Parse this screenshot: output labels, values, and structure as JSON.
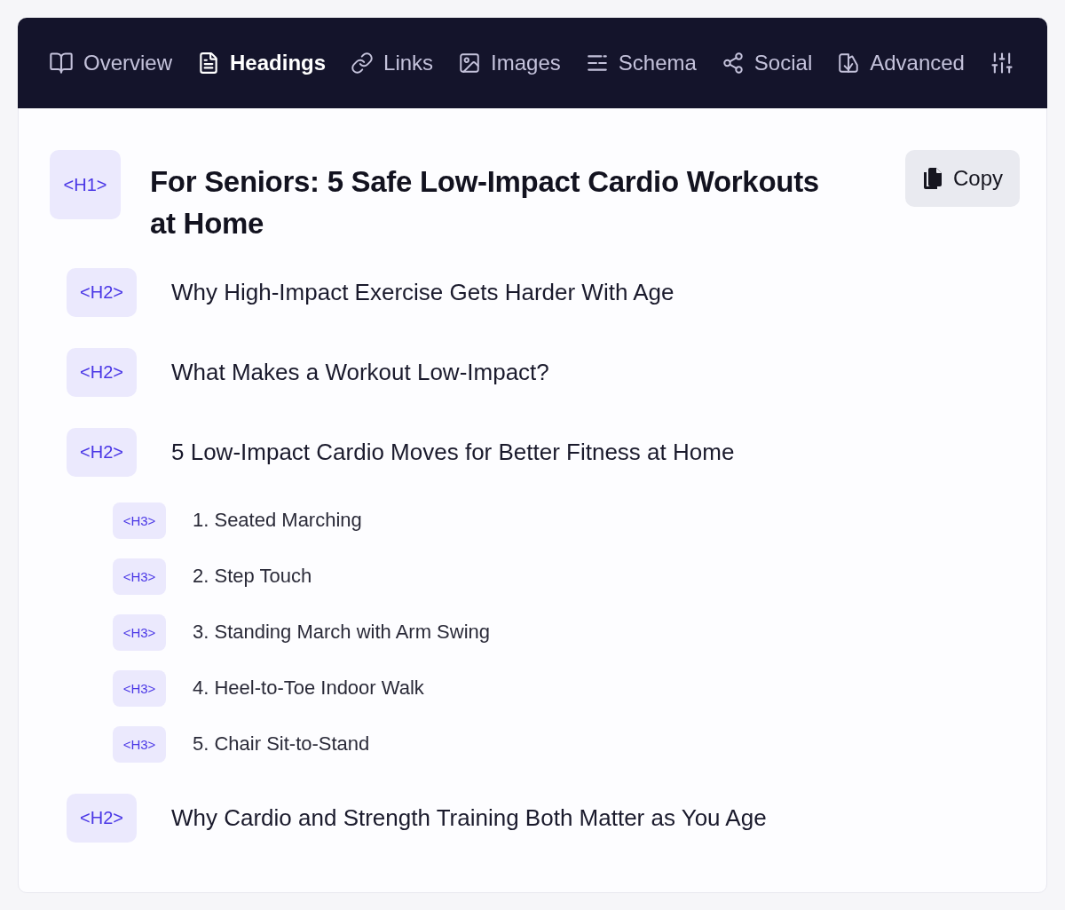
{
  "tabs": [
    {
      "label": "Overview",
      "selected": false
    },
    {
      "label": "Headings",
      "selected": true
    },
    {
      "label": "Links",
      "selected": false
    },
    {
      "label": "Images",
      "selected": false
    },
    {
      "label": "Schema",
      "selected": false
    },
    {
      "label": "Social",
      "selected": false
    },
    {
      "label": "Advanced",
      "selected": false
    }
  ],
  "copy_button": {
    "label": "Copy"
  },
  "headings": [
    {
      "tag": "<H1>",
      "text": "For Seniors: 5 Safe Low-Impact Cardio Workouts at Home",
      "children": [
        {
          "tag": "<H2>",
          "text": "Why High-Impact Exercise Gets Harder With Age"
        },
        {
          "tag": "<H2>",
          "text": "What Makes a Workout Low-Impact?"
        },
        {
          "tag": "<H2>",
          "text": "5 Low-Impact Cardio Moves for Better Fitness at Home",
          "children": [
            {
              "tag": "<H3>",
              "text": "1. Seated Marching"
            },
            {
              "tag": "<H3>",
              "text": "2. Step Touch"
            },
            {
              "tag": "<H3>",
              "text": "3. Standing March with Arm Swing"
            },
            {
              "tag": "<H3>",
              "text": "4. Heel-to-Toe Indoor Walk"
            },
            {
              "tag": "<H3>",
              "text": "5. Chair Sit-to-Stand"
            }
          ]
        },
        {
          "tag": "<H2>",
          "text": "Why Cardio and Strength Training Both Matter as You Age"
        }
      ]
    }
  ]
}
